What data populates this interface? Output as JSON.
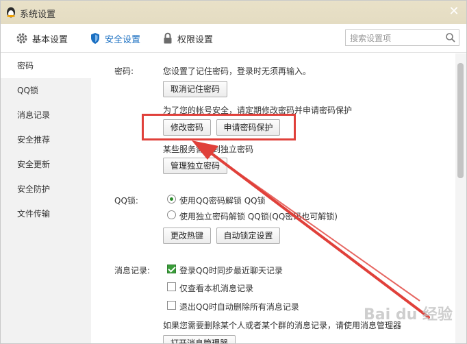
{
  "window": {
    "title": "系统设置",
    "close_glyph": "✕"
  },
  "tabs": [
    {
      "label": "基本设置",
      "icon": "gear-icon"
    },
    {
      "label": "安全设置",
      "icon": "shield-icon",
      "active": true
    },
    {
      "label": "权限设置",
      "icon": "lock-icon"
    }
  ],
  "search": {
    "placeholder": "搜索设置项"
  },
  "sidebar": {
    "items": [
      {
        "label": "密码",
        "active": true
      },
      {
        "label": "QQ锁"
      },
      {
        "label": "消息记录"
      },
      {
        "label": "安全推荐"
      },
      {
        "label": "安全更新"
      },
      {
        "label": "安全防护"
      },
      {
        "label": "文件传输"
      }
    ]
  },
  "password": {
    "label": "密码:",
    "remembered_text": "您设置了记住密码，登录时无须再输入。",
    "cancel_remember_button": "取消记住密码",
    "safety_tip": "为了您的帐号安全，请定期修改密码并申请密码保护",
    "change_password_button": "修改密码",
    "apply_protection_button": "申请密码保护",
    "independent_tip": "某些服务需用到独立密码",
    "manage_independent_button": "管理独立密码"
  },
  "qq_lock": {
    "label": "QQ锁:",
    "option1": "使用QQ密码解锁 QQ锁",
    "option2": "使用独立密码解锁 QQ锁(QQ密码也可解锁)",
    "change_hotkey_button": "更改热键",
    "auto_lock_button": "自动锁定设置"
  },
  "message_record": {
    "label": "消息记录:",
    "option1": "登录QQ时同步最近聊天记录",
    "option2": "仅查看本机消息记录",
    "option3": "退出QQ时自动删除所有消息记录",
    "manager_tip": "如果您需要删除某个人或者某个群的消息记录，请使用消息管理器",
    "open_manager_button": "打开消息管理器"
  },
  "watermark": {
    "text": "Bai du 经验"
  },
  "colors": {
    "accent": "#1a6fc1",
    "highlight": "#e0403a",
    "titlebar": "#e6dec4"
  }
}
